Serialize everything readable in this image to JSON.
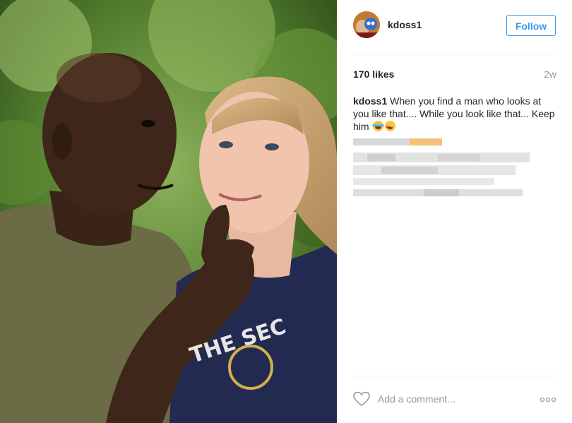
{
  "post": {
    "username": "kdoss1",
    "follow_label": "Follow",
    "likes": "170 likes",
    "age": "2w",
    "caption": {
      "author": "kdoss1",
      "text": "When you find a man who looks at you like that.... While you look like that... Keep him"
    },
    "caption_emojis": [
      "tears-of-joy-emoji",
      "heart-eyes-emoji"
    ],
    "comment_placeholder": "Add a comment..."
  },
  "photo": {
    "shirt_print": "THE SEC"
  },
  "colors": {
    "accent": "#3897f0",
    "secondary_text": "#999999",
    "divider": "#efefef"
  }
}
